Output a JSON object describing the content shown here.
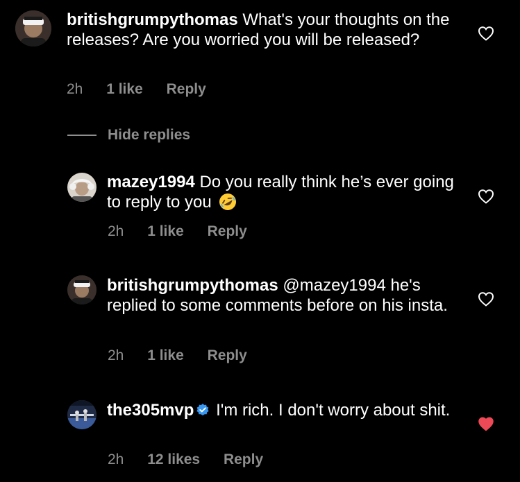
{
  "comments": [
    {
      "username": "britishgrumpythomas",
      "text": "What's your thoughts on the releases? Are you worried you will be released?",
      "time": "2h",
      "likes": "1 like",
      "reply": "Reply",
      "liked": false
    },
    {
      "username": "mazey1994",
      "text": "Do you really think he’s ever going to reply to you",
      "emoji": "rolling-on-floor-laughing-emoji",
      "time": "2h",
      "likes": "1 like",
      "reply": "Reply",
      "liked": false
    },
    {
      "username": "britishgrumpythomas",
      "text": "@mazey1994 he's replied to some comments before on his insta.",
      "time": "2h",
      "likes": "1 like",
      "reply": "Reply",
      "liked": false
    },
    {
      "username": "the305mvp",
      "verified": true,
      "text": "I'm rich. I don't worry about shit.",
      "time": "2h",
      "likes": "12 likes",
      "reply": "Reply",
      "liked": true
    }
  ],
  "hide_replies_label": "Hide replies",
  "colors": {
    "background": "#000000",
    "text": "#ffffff",
    "muted": "#8e8e8e",
    "like_red": "#ed4956",
    "verified_blue": "#3897f0"
  }
}
